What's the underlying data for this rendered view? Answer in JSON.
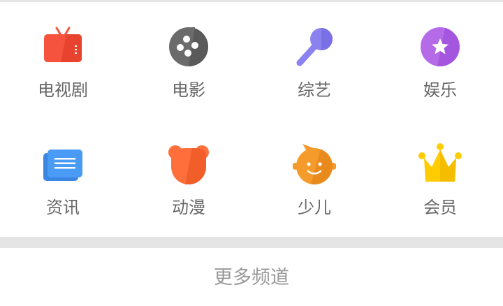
{
  "channels": [
    {
      "label": "电视剧",
      "icon": "tv-icon",
      "color": "#F5533D"
    },
    {
      "label": "电影",
      "icon": "film-reel-icon",
      "color": "#666666"
    },
    {
      "label": "综艺",
      "icon": "microphone-icon",
      "color": "#8B82F0"
    },
    {
      "label": "娱乐",
      "icon": "star-badge-icon",
      "color": "#B56AE8"
    },
    {
      "label": "资讯",
      "icon": "news-icon",
      "color": "#4A9BF5"
    },
    {
      "label": "动漫",
      "icon": "bear-icon",
      "color": "#FF6F3C"
    },
    {
      "label": "少儿",
      "icon": "child-face-icon",
      "color": "#F49B2C"
    },
    {
      "label": "会员",
      "icon": "crown-icon",
      "color": "#FFCC00"
    }
  ],
  "more": {
    "label": "更多频道"
  }
}
